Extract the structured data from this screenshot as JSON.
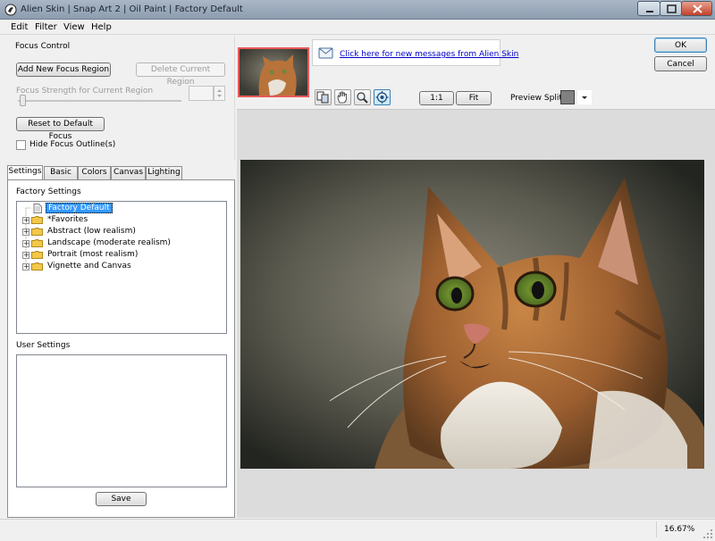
{
  "window": {
    "title": "Alien Skin | Snap Art 2 | Oil Paint | Factory Default"
  },
  "menu": [
    "Edit",
    "Filter",
    "View",
    "Help"
  ],
  "focus_control": {
    "group_label": "Focus Control",
    "add_button": "Add New Focus Region",
    "delete_button": "Delete Current Region",
    "strength_label": "Focus Strength for Current Region",
    "reset_button": "Reset to Default Focus",
    "hide_outline_label": "Hide Focus Outline(s)",
    "hide_outline_checked": false
  },
  "tabs": [
    "Settings",
    "Basic",
    "Colors",
    "Canvas",
    "Lighting"
  ],
  "active_tab": "Settings",
  "settings": {
    "factory_label": "Factory Settings",
    "factory_items": [
      {
        "label": "Factory Default",
        "selected": true,
        "expandable": false,
        "icon": "file-icon"
      },
      {
        "label": "*Favorites",
        "selected": false,
        "expandable": true,
        "icon": "folder-icon"
      },
      {
        "label": "Abstract (low realism)",
        "selected": false,
        "expandable": true,
        "icon": "folder-icon"
      },
      {
        "label": "Landscape (moderate realism)",
        "selected": false,
        "expandable": true,
        "icon": "folder-icon"
      },
      {
        "label": "Portrait (most realism)",
        "selected": false,
        "expandable": true,
        "icon": "folder-icon"
      },
      {
        "label": "Vignette and Canvas",
        "selected": false,
        "expandable": true,
        "icon": "folder-icon"
      }
    ],
    "user_label": "User Settings",
    "save_button": "Save"
  },
  "messages": {
    "link_text": "Click here for new messages from Alien Skin"
  },
  "dialog_buttons": {
    "ok": "OK",
    "cancel": "Cancel"
  },
  "toolbar": {
    "tools": [
      "compare-icon",
      "hand-icon",
      "zoom-icon",
      "focus-icon"
    ],
    "active_tool": "focus-icon",
    "zoom_1to1": "1:1",
    "zoom_fit": "Fit",
    "preview_split_label": "Preview Split:"
  },
  "status": {
    "zoom": "16.67%"
  },
  "colors": {
    "title_bar": "#9aa9bb",
    "selection": "#3399ff",
    "link": "#0000cc",
    "thumbnail_border": "#e85858"
  }
}
